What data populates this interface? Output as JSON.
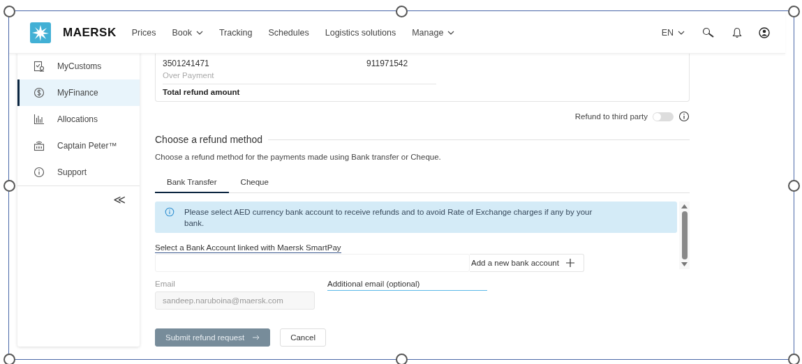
{
  "header": {
    "logo": "MAERSK",
    "nav": [
      {
        "label": "Prices",
        "dropdown": false
      },
      {
        "label": "Book",
        "dropdown": true
      },
      {
        "label": "Tracking",
        "dropdown": false
      },
      {
        "label": "Schedules",
        "dropdown": false
      },
      {
        "label": "Logistics solutions",
        "dropdown": false
      },
      {
        "label": "Manage",
        "dropdown": true
      }
    ],
    "language": "EN"
  },
  "sidebar": {
    "items": [
      {
        "label": "MyCustoms",
        "kind": "customs",
        "selected": false
      },
      {
        "label": "MyFinance",
        "kind": "finance",
        "selected": true
      },
      {
        "label": "Allocations",
        "kind": "chart",
        "selected": false
      },
      {
        "label": "Captain Peter™",
        "kind": "device",
        "selected": false
      },
      {
        "label": "Support",
        "kind": "info",
        "selected": false
      }
    ],
    "collapse": "≪"
  },
  "refunds_table": {
    "rows": [
      {
        "column_1": "3501241471",
        "column_2": "911971542",
        "note": "Over Payment"
      }
    ],
    "total_label": "Total refund amount"
  },
  "third_party": {
    "label": "Refund to third party",
    "on": false
  },
  "refund_method": {
    "title": "Choose a refund method",
    "description": "Choose a refund method for the payments made using Bank transfer or Cheque.",
    "tabs": [
      {
        "label": "Bank Transfer",
        "selected": true
      },
      {
        "label": "Cheque",
        "selected": false
      }
    ],
    "notice": "Please select AED currency bank account to receive refunds and to avoid Rate of Exchange charges if any by your bank.",
    "bank_account": {
      "label": "Select a Bank Account linked with Maersk SmartPay"
    },
    "add_button": "Add a new bank account",
    "email": {
      "label": "Email",
      "value": "sandeep.naruboina@maersk.com",
      "disabled": true
    },
    "additional_email": {
      "label": "Additional email (optional)"
    }
  },
  "actions": [
    {
      "label": "Submit refund request",
      "kind": "primary",
      "disabled": true
    },
    {
      "label": "Cancel",
      "kind": "secondary",
      "disabled": false
    }
  ]
}
